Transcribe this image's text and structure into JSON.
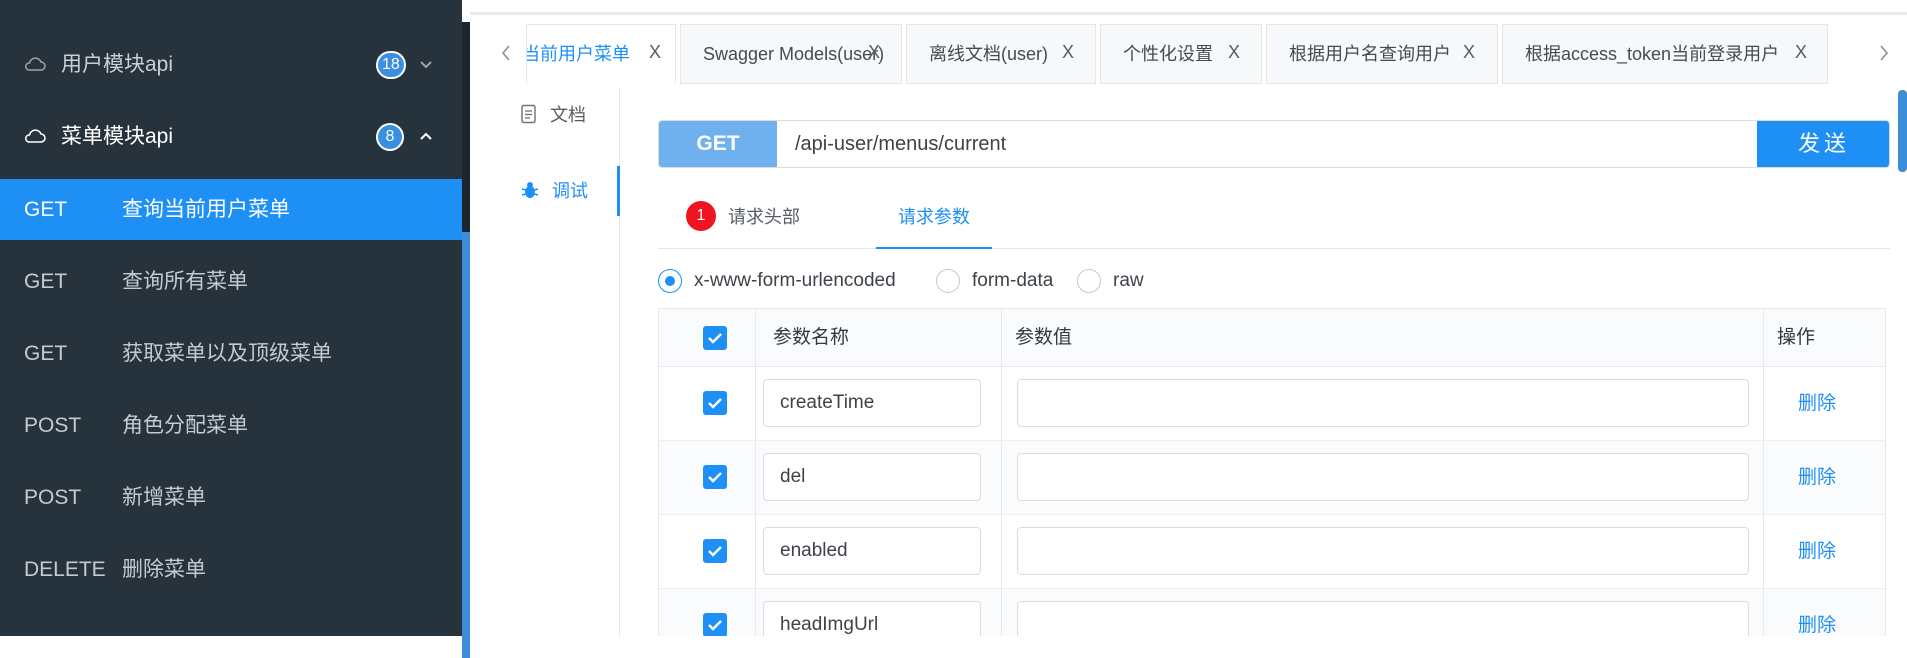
{
  "sidebar": {
    "groups": [
      {
        "title": "用户模块api",
        "count": "18",
        "state": "collapsed"
      },
      {
        "title": "菜单模块api",
        "count": "8",
        "state": "expanded"
      }
    ],
    "items": [
      {
        "method": "GET",
        "label": "查询当前用户菜单",
        "active": true
      },
      {
        "method": "GET",
        "label": "查询所有菜单"
      },
      {
        "method": "GET",
        "label": "获取菜单以及顶级菜单"
      },
      {
        "method": "POST",
        "label": "角色分配菜单"
      },
      {
        "method": "POST",
        "label": "新增菜单"
      },
      {
        "method": "DELETE",
        "label": "删除菜单"
      }
    ]
  },
  "tabs": [
    {
      "label": "查询当前用户菜单",
      "active": true
    },
    {
      "label": "Swagger Models(user)"
    },
    {
      "label": "离线文档(user)"
    },
    {
      "label": "个性化设置"
    },
    {
      "label": "根据用户名查询用户"
    },
    {
      "label": "根据access_token当前登录用户"
    }
  ],
  "tab_close_glyph": "X",
  "doc_nav": {
    "doc": "文档",
    "debug": "调试"
  },
  "request": {
    "method": "GET",
    "url": "/api-user/menus/current",
    "send_label": "发送"
  },
  "subtabs": {
    "headers_label": "请求头部",
    "headers_error_count": "1",
    "params_label": "请求参数"
  },
  "body_type": {
    "options": [
      "x-www-form-urlencoded",
      "form-data",
      "raw"
    ],
    "selected": "x-www-form-urlencoded"
  },
  "params_table": {
    "columns": {
      "name": "参数名称",
      "value": "参数值",
      "action": "操作"
    },
    "rows": [
      {
        "name": "createTime",
        "value": "",
        "checked": true,
        "action": "删除"
      },
      {
        "name": "del",
        "value": "",
        "checked": true,
        "action": "删除"
      },
      {
        "name": "enabled",
        "value": "",
        "checked": true,
        "action": "删除"
      },
      {
        "name": "headImgUrl",
        "value": "",
        "checked": true,
        "action": "删除"
      }
    ]
  },
  "colors": {
    "sidebar_bg": "#27333c",
    "accent": "#1e90f5",
    "method_get": "#6fb0ef",
    "error_badge": "#f0141e"
  },
  "icons": {
    "group": "cloud-icon",
    "doc": "document-icon",
    "debug": "bug-icon",
    "tab_prev": "chevron-left-icon",
    "tab_next": "chevron-right-icon"
  }
}
